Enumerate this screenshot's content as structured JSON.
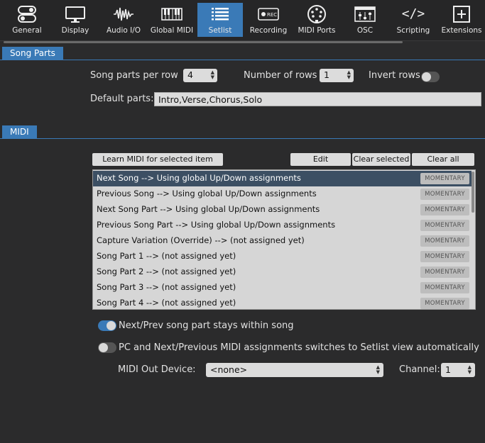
{
  "toolbar": {
    "items": [
      {
        "label": "General",
        "icon": "toggles-icon"
      },
      {
        "label": "Display",
        "icon": "monitor-icon"
      },
      {
        "label": "Audio I/O",
        "icon": "waveform-icon"
      },
      {
        "label": "Global MIDI",
        "icon": "keyboard-icon"
      },
      {
        "label": "Setlist",
        "icon": "list-icon"
      },
      {
        "label": "Recording",
        "icon": "rec-icon"
      },
      {
        "label": "MIDI Ports",
        "icon": "midi-port-icon"
      },
      {
        "label": "OSC",
        "icon": "sliders-icon"
      },
      {
        "label": "Scripting",
        "icon": "code-icon"
      },
      {
        "label": "Extensions",
        "icon": "plus-box-icon"
      }
    ],
    "active": "Setlist",
    "rec_badge": "REC",
    "code_glyph": "</>"
  },
  "song_parts": {
    "tab_label": "Song Parts",
    "per_row_label": "Song parts per row",
    "per_row_value": "4",
    "rows_label": "Number of rows",
    "rows_value": "1",
    "invert_label": "Invert rows",
    "invert_on": false,
    "default_label": "Default parts:",
    "default_value": "Intro,Verse,Chorus,Solo"
  },
  "midi": {
    "tab_label": "MIDI",
    "learn_button": "Learn MIDI for selected item",
    "edit_button": "Edit",
    "clear_selected_button": "Clear selected",
    "clear_all_button": "Clear all",
    "mode_label": "MOMENTARY",
    "items": [
      "Next Song --> Using global Up/Down assignments",
      "Previous Song --> Using global Up/Down assignments",
      "Next Song Part --> Using global Up/Down assignments",
      "Previous Song Part --> Using global Up/Down assignments",
      "Capture Variation (Override) --> (not assigned yet)",
      "Song Part 1 --> (not assigned yet)",
      "Song Part 2 --> (not assigned yet)",
      "Song Part 3 --> (not assigned yet)",
      "Song Part 4 --> (not assigned yet)"
    ],
    "selected_index": 0,
    "option1_label": "Next/Prev song part stays within song",
    "option1_on": true,
    "option2_label": "PC and Next/Previous MIDI assignments switches to Setlist view automatically",
    "option2_on": false,
    "out_device_label": "MIDI Out Device:",
    "out_device_value": "<none>",
    "channel_label": "Channel:",
    "channel_value": "1"
  }
}
